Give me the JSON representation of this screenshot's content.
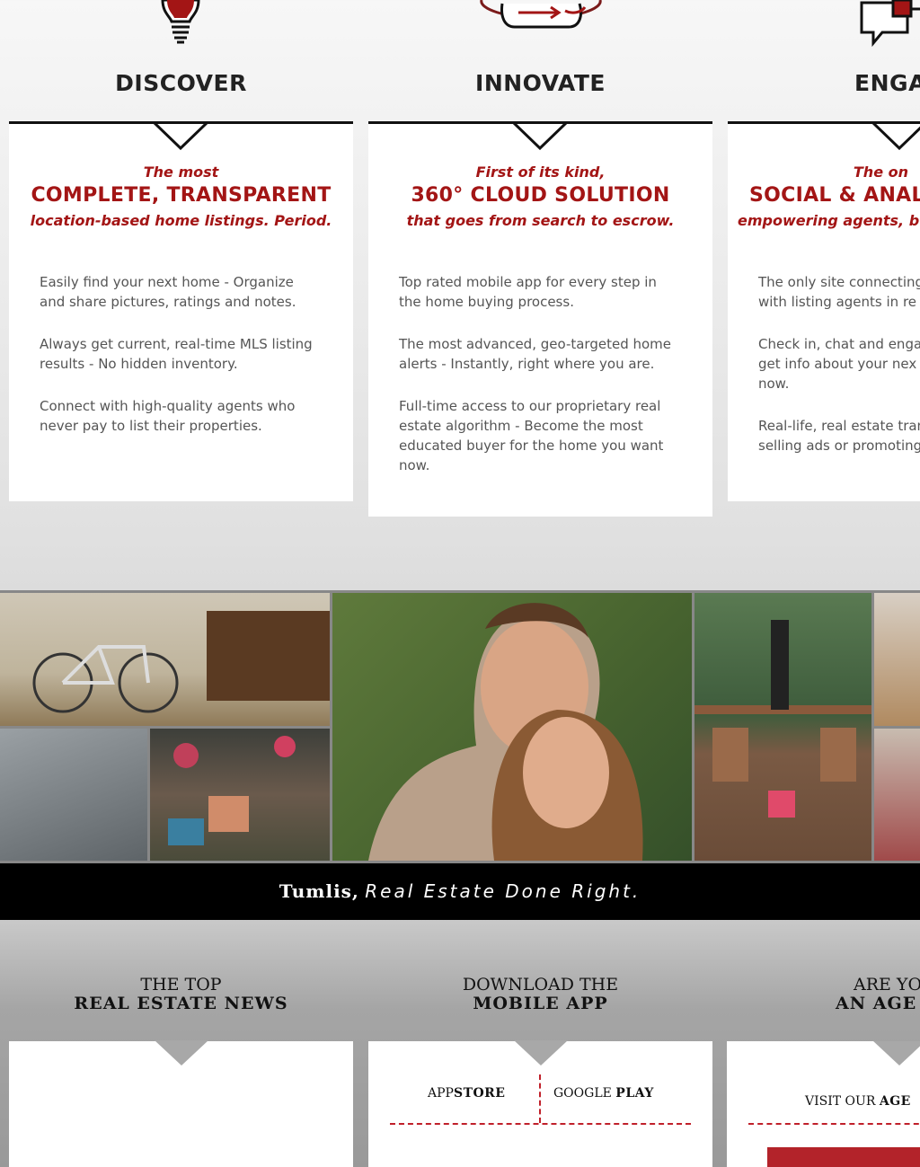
{
  "columns": [
    {
      "title": "DISCOVER",
      "icon": "lightbulb-icon",
      "tag_top": "The most",
      "tag_mid": "COMPLETE, TRANSPARENT",
      "tag_bot": "location-based home listings. Period.",
      "bullets": [
        "Easily find your next home - Organize and share pictures, ratings and notes.",
        "Always get current, real-time MLS listing results - No hidden inventory.",
        "Connect with high-quality agents who never pay to list their properties."
      ]
    },
    {
      "title": "INNOVATE",
      "icon": "cloud-orbit-icon",
      "tag_top": "First of its kind,",
      "tag_mid": "360° CLOUD SOLUTION",
      "tag_bot": "that goes from search to escrow.",
      "bullets": [
        "Top rated mobile app for every step in the home buying process.",
        "The most advanced, geo-targeted home alerts - Instantly, right where you are.",
        "Full-time access to our proprietary real estate algorithm - Become the most educated buyer for the home you want now."
      ]
    },
    {
      "title": "ENGAG",
      "icon": "chat-bubble-icon",
      "tag_top": "The on",
      "tag_mid": "SOCIAL & ANALY",
      "tag_bot": "empowering agents, b",
      "bullets": [
        "The only site connecting with listing agents in re",
        "Check in, chat and enga get info about your nex now.",
        "Real-life, real estate tran selling ads or promoting"
      ]
    }
  ],
  "tagline": {
    "brand": "Tumlis,",
    "slogan": "Real Estate Done Right."
  },
  "bottom": {
    "news": {
      "line1": "THE TOP",
      "line2": "REAL ESTATE NEWS"
    },
    "app": {
      "line1": "DOWNLOAD THE",
      "line2": "MOBILE APP",
      "appstore_pre": "APP",
      "appstore_bold": "STORE",
      "google_pre": "GOOGLE ",
      "google_bold": "PLAY"
    },
    "agent": {
      "line1": "ARE YO",
      "line2": "AN AGE",
      "visit_pre": "VISIT OUR ",
      "visit_bold": "AGE"
    }
  },
  "colors": {
    "accent": "#a31515",
    "dark": "#111111",
    "text": "#555555"
  }
}
